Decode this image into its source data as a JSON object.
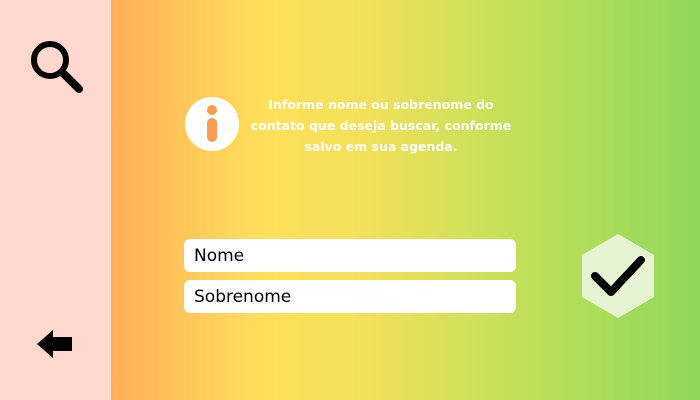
{
  "sidebar": {
    "search_icon": "search-icon",
    "back_icon": "arrow-left-icon",
    "background": "#ffd8cf"
  },
  "info": {
    "icon": "info-icon",
    "message": "Informe nome ou sobrenome do contato que deseja buscar, conforme salvo em sua agenda."
  },
  "form": {
    "name_placeholder": "Nome",
    "surname_placeholder": "Sobrenome"
  },
  "confirm": {
    "icon": "checkmark-icon",
    "background": "#e6f4d4"
  },
  "colors": {
    "gradient_start": "#ff8f56",
    "gradient_mid": "#ffe05a",
    "gradient_end": "#8fd85a",
    "text": "#ffffff"
  }
}
